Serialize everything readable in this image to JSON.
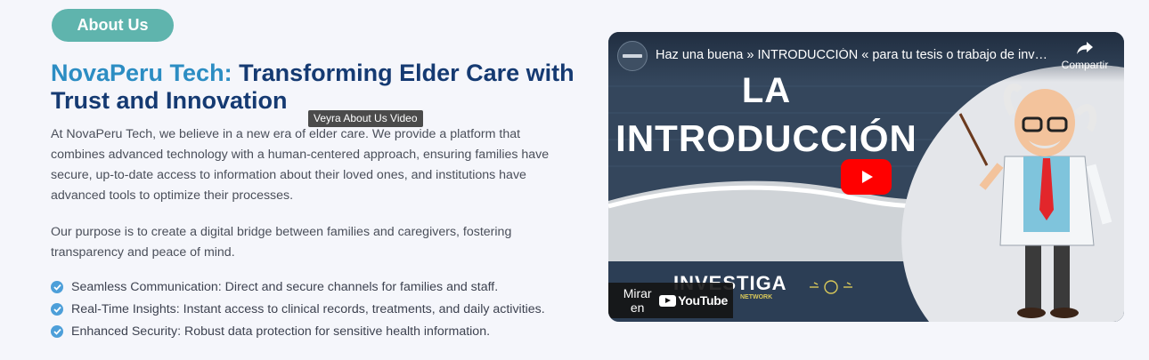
{
  "badge": {
    "label": "About Us"
  },
  "heading": {
    "accent": "NovaPeru Tech:",
    "rest": " Transforming Elder Care with Trust and Innovation"
  },
  "tooltip": {
    "text": "Veyra About Us Video"
  },
  "paragraphs": [
    "At NovaPeru Tech, we believe in a new era of elder care. We provide a platform that combines advanced technology with a human-centered approach, ensuring families have secure, up-to-date access to information about their loved ones, and institutions have advanced tools to optimize their processes.",
    "Our purpose is to create a digital bridge between families and caregivers, fostering transparency and peace of mind."
  ],
  "features": [
    "Seamless Communication: Direct and secure channels for families and staff.",
    "Real-Time Insights: Instant access to clinical records, treatments, and daily activities.",
    "Enhanced Security: Robust data protection for sensitive health information."
  ],
  "video": {
    "title": "Haz una buena » INTRODUCCIÓN « para tu tesis o trabajo de investigación",
    "share_label": "Compartir",
    "thumb_line1": "LA",
    "thumb_line2": "INTRODUCCIÓN",
    "thumb_brand": "INVESTIGA",
    "thumb_brand_sub": "NETWORK",
    "channel_text": "INVESTIGA",
    "watch_label": "Mirar en",
    "youtube_label": "YouTube"
  },
  "colors": {
    "badge": "#5fb4ad",
    "heading_accent": "#2c8dc3",
    "heading": "#153a72",
    "check": "#4d9fd9",
    "play": "#ff0000"
  }
}
